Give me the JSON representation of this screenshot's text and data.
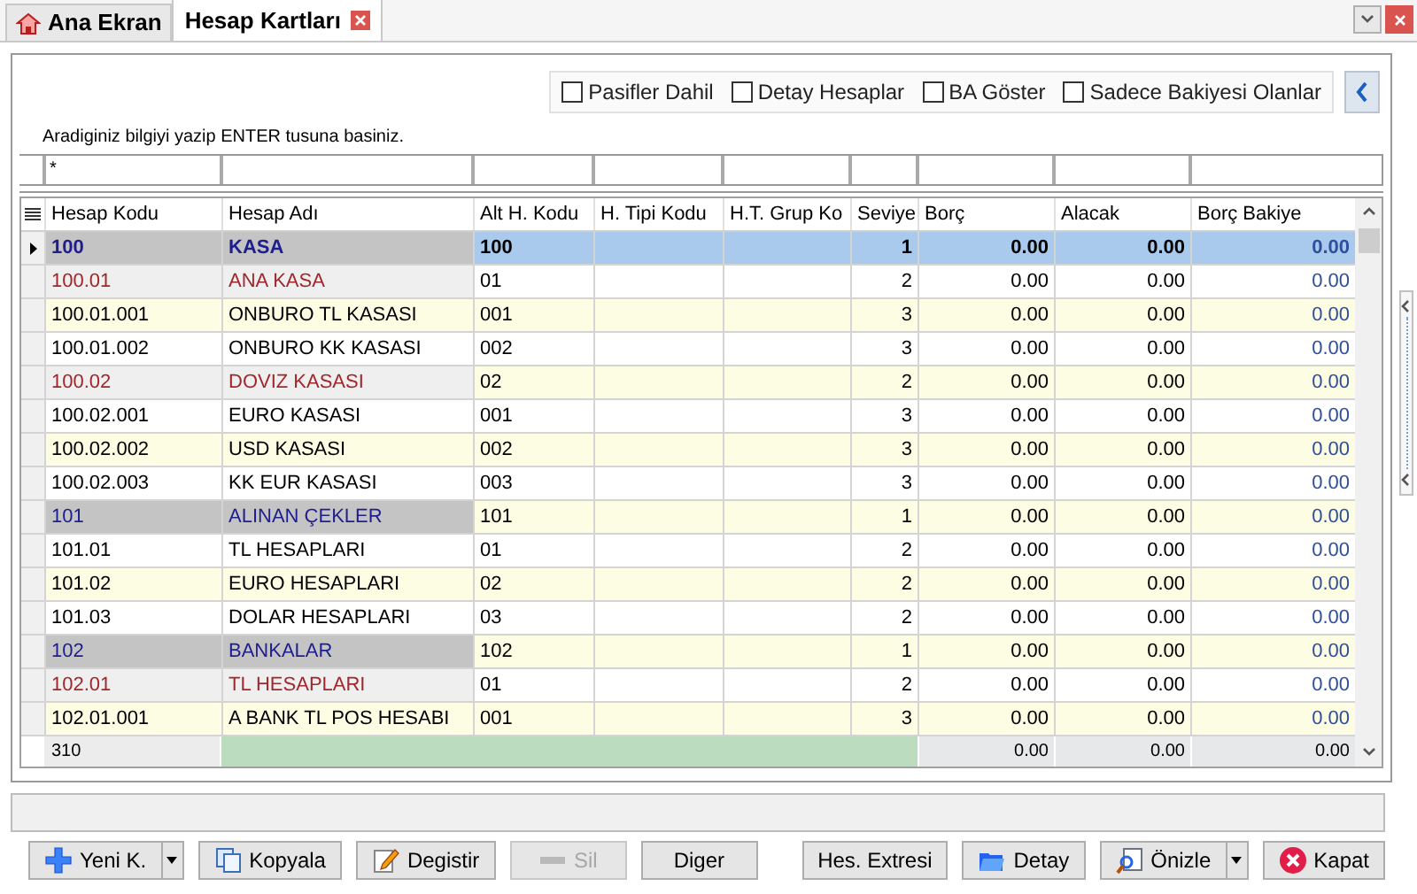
{
  "tabs": [
    {
      "label": "Ana Ekran",
      "selected": false,
      "kind": "home"
    },
    {
      "label": "Hesap Kartları",
      "selected": true,
      "kind": "closable"
    }
  ],
  "options": [
    {
      "label": "Pasifler Dahil",
      "checked": false
    },
    {
      "label": "Detay Hesaplar",
      "checked": false
    },
    {
      "label": "BA Göster",
      "checked": false
    },
    {
      "label": "Sadece Bakiyesi Olanlar",
      "checked": false
    }
  ],
  "search_hint": "Aradiginiz bilgiyi yazip ENTER tusuna basiniz.",
  "filter": {
    "value": "*"
  },
  "columns": [
    "Hesap Kodu",
    "Hesap Adı",
    "Alt H. Kodu",
    "H. Tipi Kodu",
    "H.T. Grup Ko",
    "Seviye",
    "Borç",
    "Alacak",
    "Borç Bakiye"
  ],
  "rows": [
    {
      "kind": "group",
      "selected": true,
      "code": "100",
      "name": "KASA",
      "alt_code": "100",
      "seviye": "1",
      "borc": "0.00",
      "alacak": "0.00",
      "borc_bakiye": "0.00"
    },
    {
      "kind": "sub",
      "selected": false,
      "code": "100.01",
      "name": "ANA KASA",
      "alt_code": "01",
      "seviye": "2",
      "borc": "0.00",
      "alacak": "0.00",
      "borc_bakiye": "0.00"
    },
    {
      "kind": "leaf",
      "selected": false,
      "code": "100.01.001",
      "name": "ONBURO TL KASASI",
      "alt_code": "001",
      "seviye": "3",
      "borc": "0.00",
      "alacak": "0.00",
      "borc_bakiye": "0.00"
    },
    {
      "kind": "leaf",
      "selected": false,
      "code": "100.01.002",
      "name": "ONBURO KK KASASI",
      "alt_code": "002",
      "seviye": "3",
      "borc": "0.00",
      "alacak": "0.00",
      "borc_bakiye": "0.00"
    },
    {
      "kind": "sub",
      "selected": false,
      "code": "100.02",
      "name": "DOVIZ KASASI",
      "alt_code": "02",
      "seviye": "2",
      "borc": "0.00",
      "alacak": "0.00",
      "borc_bakiye": "0.00"
    },
    {
      "kind": "leaf",
      "selected": false,
      "code": "100.02.001",
      "name": "EURO KASASI",
      "alt_code": "001",
      "seviye": "3",
      "borc": "0.00",
      "alacak": "0.00",
      "borc_bakiye": "0.00"
    },
    {
      "kind": "leaf",
      "selected": false,
      "code": "100.02.002",
      "name": "USD KASASI",
      "alt_code": "002",
      "seviye": "3",
      "borc": "0.00",
      "alacak": "0.00",
      "borc_bakiye": "0.00"
    },
    {
      "kind": "leaf",
      "selected": false,
      "code": "100.02.003",
      "name": "KK EUR KASASI",
      "alt_code": "003",
      "seviye": "3",
      "borc": "0.00",
      "alacak": "0.00",
      "borc_bakiye": "0.00"
    },
    {
      "kind": "group",
      "selected": false,
      "code": "101",
      "name": "ALINAN ÇEKLER",
      "alt_code": "101",
      "seviye": "1",
      "borc": "0.00",
      "alacak": "0.00",
      "borc_bakiye": "0.00"
    },
    {
      "kind": "leaf",
      "selected": false,
      "code": "101.01",
      "name": "TL HESAPLARI",
      "alt_code": "01",
      "seviye": "2",
      "borc": "0.00",
      "alacak": "0.00",
      "borc_bakiye": "0.00"
    },
    {
      "kind": "leaf",
      "selected": false,
      "code": "101.02",
      "name": "EURO HESAPLARI",
      "alt_code": "02",
      "seviye": "2",
      "borc": "0.00",
      "alacak": "0.00",
      "borc_bakiye": "0.00"
    },
    {
      "kind": "leaf",
      "selected": false,
      "code": "101.03",
      "name": "DOLAR HESAPLARI",
      "alt_code": "03",
      "seviye": "2",
      "borc": "0.00",
      "alacak": "0.00",
      "borc_bakiye": "0.00"
    },
    {
      "kind": "group",
      "selected": false,
      "code": "102",
      "name": "BANKALAR",
      "alt_code": "102",
      "seviye": "1",
      "borc": "0.00",
      "alacak": "0.00",
      "borc_bakiye": "0.00"
    },
    {
      "kind": "sub",
      "selected": false,
      "code": "102.01",
      "name": "TL HESAPLARI",
      "alt_code": "01",
      "seviye": "2",
      "borc": "0.00",
      "alacak": "0.00",
      "borc_bakiye": "0.00"
    },
    {
      "kind": "leaf",
      "selected": false,
      "code": "102.01.001",
      "name": "A BANK TL POS HESABI",
      "alt_code": "001",
      "seviye": "3",
      "borc": "0.00",
      "alacak": "0.00",
      "borc_bakiye": "0.00"
    }
  ],
  "footer": {
    "count": "310",
    "totals": [
      "0.00",
      "0.00",
      "0.00"
    ]
  },
  "buttons": [
    {
      "label": "Yeni K.",
      "kind": "plus",
      "dropdown": true,
      "disabled": false
    },
    {
      "label": "Kopyala",
      "kind": "copy",
      "dropdown": false,
      "disabled": false
    },
    {
      "label": "Degistir",
      "kind": "edit",
      "dropdown": false,
      "disabled": false
    },
    {
      "label": "Sil",
      "kind": "minus",
      "dropdown": false,
      "disabled": true
    },
    {
      "label": "Diger",
      "kind": "text",
      "dropdown": false,
      "disabled": false
    },
    {
      "label": "Hes. Extresi",
      "kind": "text",
      "dropdown": false,
      "disabled": false
    },
    {
      "label": "Detay",
      "kind": "folder",
      "dropdown": false,
      "disabled": false
    },
    {
      "label": "Önizle",
      "kind": "preview",
      "dropdown": true,
      "disabled": false
    },
    {
      "label": "Kapat",
      "kind": "close",
      "dropdown": false,
      "disabled": false
    }
  ]
}
